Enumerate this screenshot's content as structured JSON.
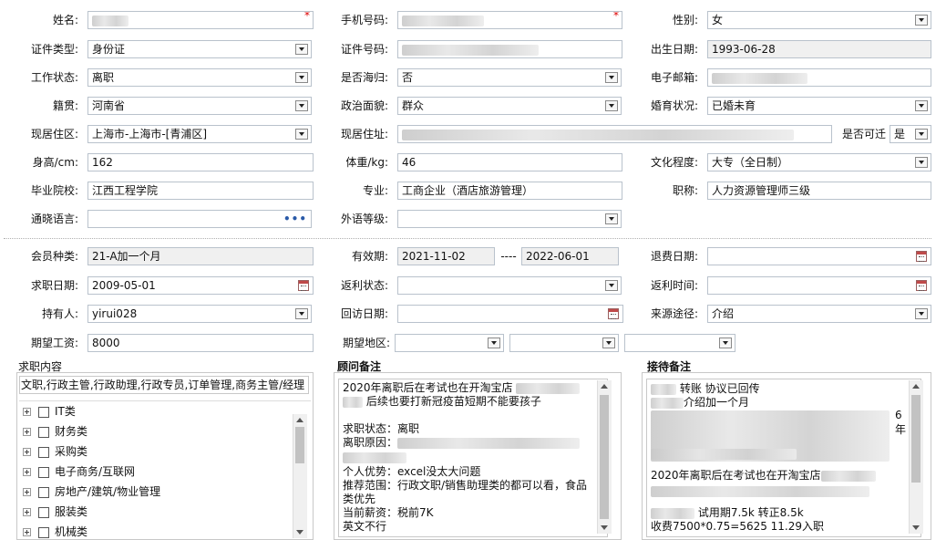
{
  "basic": {
    "name_label": "姓名:",
    "phone_label": "手机号码:",
    "gender_label": "性别:",
    "gender_value": "女",
    "id_type_label": "证件类型:",
    "id_type_value": "身份证",
    "id_no_label": "证件号码:",
    "birth_label": "出生日期:",
    "birth_value": "1993-06-28",
    "work_status_label": "工作状态:",
    "work_status_value": "离职",
    "overseas_label": "是否海归:",
    "overseas_value": "否",
    "email_label": "电子邮箱:",
    "native_label": "籍贯:",
    "native_value": "河南省",
    "political_label": "政治面貌:",
    "political_value": "群众",
    "marital_label": "婚育状况:",
    "marital_value": "已婚未育",
    "residence_label": "现居住区:",
    "residence_value": "上海市-上海市-[青浦区]",
    "address_label": "现居住址:",
    "relocate_label": "是否可迁",
    "relocate_value": "是",
    "height_label": "身高/cm:",
    "height_value": "162",
    "weight_label": "体重/kg:",
    "weight_value": "46",
    "education_label": "文化程度:",
    "education_value": "大专（全日制）",
    "school_label": "毕业院校:",
    "school_value": "江西工程学院",
    "major_label": "专业:",
    "major_value": "工商企业（酒店旅游管理）",
    "title_label": "职称:",
    "title_value": "人力资源管理师三级",
    "language_label": "通晓语言:",
    "language_more": "•••",
    "foreign_label": "外语等级:"
  },
  "membership": {
    "type_label": "会员种类:",
    "type_value": "21-A加一个月",
    "valid_label": "有效期:",
    "valid_from": "2021-11-02",
    "valid_sep": "----",
    "valid_to": "2022-06-01",
    "refund_label": "退费日期:",
    "job_date_label": "求职日期:",
    "job_date_value": "2009-05-01",
    "rebate_status_label": "返利状态:",
    "rebate_time_label": "返利时间:",
    "holder_label": "持有人:",
    "holder_value": "yirui028",
    "visit_label": "回访日期:",
    "source_label": "来源途径:",
    "source_value": "介绍",
    "salary_label": "期望工资:",
    "salary_value": "8000",
    "region_label": "期望地区:"
  },
  "job_panel": {
    "title": "求职内容",
    "summary": "文职,行政主管,行政助理,行政专员,订单管理,商务主管/经理",
    "categories": [
      "IT类",
      "财务类",
      "采购类",
      "电子商务/互联网",
      "房地产/建筑/物业管理",
      "服装类",
      "机械类"
    ]
  },
  "advisor_panel": {
    "title": "顾问备注",
    "line1": "2020年离职后在考试也在开淘宝店",
    "line2": "后续也要打新冠疫苗短期不能要孩子",
    "line3": "求职状态：离职",
    "line4": "离职原因：",
    "line5": "个人优势：excel没太大问题",
    "line6": "推荐范围：行政文职/销售助理类的都可以看，食品类优先",
    "line7": "当前薪资：税前7K",
    "line8": "英文不行"
  },
  "reception_panel": {
    "title": "接待备注",
    "line1": "转账 协议已回传",
    "line2": "介绍加一个月",
    "edge1": "6",
    "edge2": "年",
    "line3": "2020年离职后在考试也在开淘宝店",
    "line4": "试用期7.5k  转正8.5k",
    "line5": "收费7500*0.75=5625  11.29入职"
  }
}
